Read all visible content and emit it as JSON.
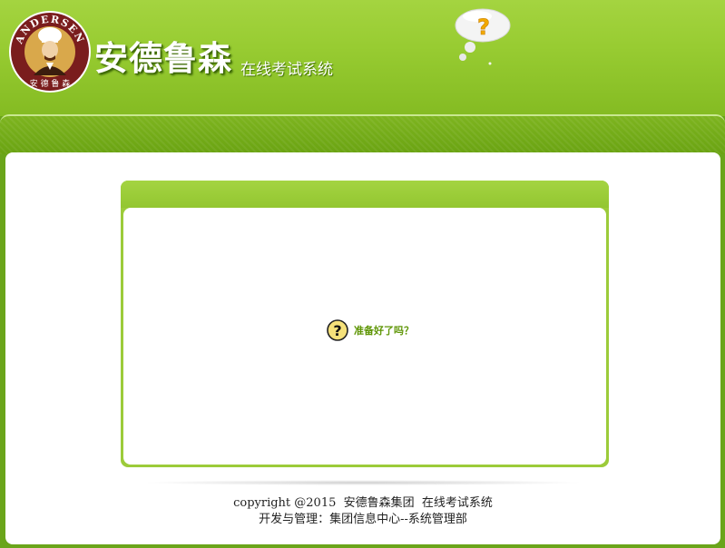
{
  "header": {
    "logo_text_top": "ANDERSEN",
    "logo_text_bottom": "安 德 鲁 森",
    "title": "安德鲁森",
    "subtitle": "在线考试系统",
    "bubble_icon": "question-bubble-icon"
  },
  "dialog": {
    "prompt_icon": "question-icon",
    "prompt_text": "准备好了吗？"
  },
  "footer": {
    "line1": "copyright @2015  安德鲁森集团  在线考试系统",
    "line2": "开发与管理：集团信息中心--系统管理部"
  },
  "colors": {
    "header_green": "#98cc32",
    "band_green": "#6aa312",
    "prompt_text": "#5f9606",
    "logo_maroon": "#7a1d1d"
  }
}
